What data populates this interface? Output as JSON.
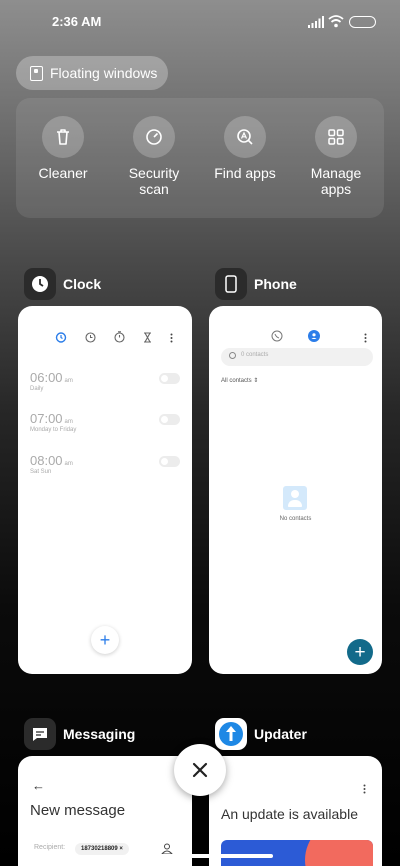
{
  "status": {
    "time": "2:36 AM"
  },
  "floating": {
    "label": "Floating windows"
  },
  "tools": [
    {
      "icon": "trash-icon",
      "label": "Cleaner"
    },
    {
      "icon": "gauge-icon",
      "label": "Security scan"
    },
    {
      "icon": "find-apps-icon",
      "label": "Find apps"
    },
    {
      "icon": "grid-icon",
      "label": "Manage apps"
    }
  ],
  "apps": {
    "clock": {
      "name": "Clock",
      "alarms": [
        {
          "time": "06:00",
          "ampm": "am",
          "sub": "Daily"
        },
        {
          "time": "07:00",
          "ampm": "am",
          "sub": "Monday to Friday"
        },
        {
          "time": "08:00",
          "ampm": "am",
          "sub": "Sat Sun"
        }
      ],
      "fab": "+"
    },
    "phone": {
      "name": "Phone",
      "search_placeholder": "0 contacts",
      "filter": "All contacts",
      "empty": "No contacts",
      "fab": "+"
    },
    "messaging": {
      "name": "Messaging",
      "back": "←",
      "title": "New message",
      "recipient_label": "Recipient:",
      "recipient_value": "18730218809 ×"
    },
    "updater": {
      "name": "Updater",
      "title": "An update is available"
    }
  },
  "close_label": "×"
}
